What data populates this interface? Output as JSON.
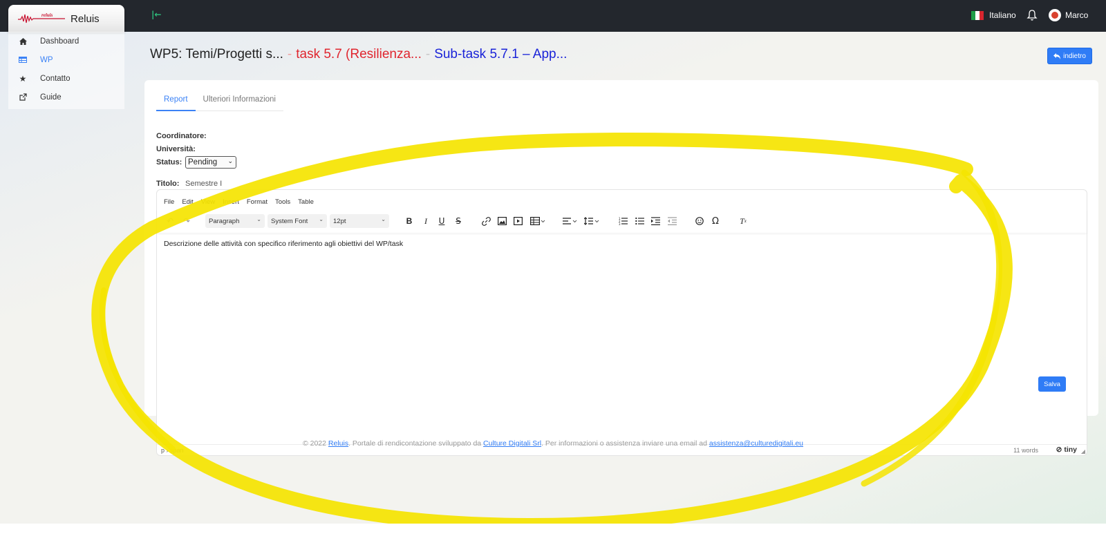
{
  "app": {
    "brand_name": "Reluis",
    "logo_text": "reluis",
    "collapse_icon": "arrow-left-to-line-icon",
    "language": "Italiano",
    "user_name": "Marco"
  },
  "sidebar": {
    "items": [
      {
        "label": "Dashboard",
        "icon": "home-icon",
        "active": false
      },
      {
        "label": "WP",
        "icon": "table-icon",
        "active": true
      },
      {
        "label": "Contatto",
        "icon": "star-icon",
        "active": false
      },
      {
        "label": "Guide",
        "icon": "external-link-icon",
        "active": false
      }
    ]
  },
  "heading": {
    "part1": "WP5: Temi/Progetti s...",
    "separator": "-",
    "part2": "task 5.7 (Resilienza...",
    "part3": "Sub-task 5.7.1 – App..."
  },
  "back_button": "indietro",
  "tabs": [
    "Report",
    "Ulteriori Informazioni"
  ],
  "fields": {
    "coordinatore_label": "Coordinatore:",
    "universita_label": "Università:",
    "status_label": "Status:",
    "status_value": "Pending",
    "titolo_label": "Titolo:",
    "titolo_value": "Semestre I"
  },
  "editor": {
    "menu": [
      "File",
      "Edit",
      "View",
      "Insert",
      "Format",
      "Tools",
      "Table"
    ],
    "block_format": "Paragraph",
    "font_family": "System Font",
    "font_size": "12pt",
    "content": "Descrizione delle attività con specifico riferimento agli obiettivi del WP/task",
    "path": "p › span",
    "word_count": "11 words",
    "brand": "tiny"
  },
  "save_button": "Salva",
  "footer": {
    "prefix": "© 2022",
    "reluis_link": "Reluis",
    "middle": ". Portale di rendicontazione sviluppato da",
    "company_link": "Culture Digitali Srl",
    "after_company": ". Per informazioni o assistenza inviare una email ad",
    "email_link": "assistenza@culturedigitali.eu"
  },
  "colors": {
    "topbar": "#23272d",
    "accent": "#2f7cf6",
    "crumb_red": "#e0252e",
    "crumb_blue": "#1a23d8",
    "highlight_yellow": "#f5e400"
  }
}
